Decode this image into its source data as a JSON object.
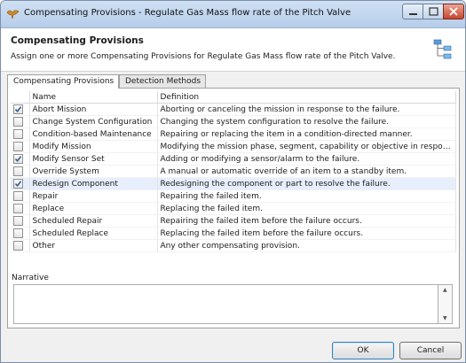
{
  "window": {
    "title": "Compensating Provisions - Regulate Gas Mass flow rate of the Pitch Valve"
  },
  "header": {
    "title": "Compensating Provisions",
    "subtitle": "Assign one or more Compensating Provisions for Regulate Gas Mass flow rate of the Pitch Valve."
  },
  "tabs": [
    {
      "label": "Compensating Provisions",
      "active": true
    },
    {
      "label": "Detection Methods",
      "active": false
    }
  ],
  "table": {
    "columns": [
      "Name",
      "Definition"
    ],
    "rows": [
      {
        "checked": true,
        "name": "Abort Mission",
        "definition": "Aborting or canceling the mission in response to the failure."
      },
      {
        "checked": false,
        "name": "Change System Configuration",
        "definition": "Changing the system configuration to resolve the failure."
      },
      {
        "checked": false,
        "name": "Condition-based Maintenance",
        "definition": "Repairing or replacing the item in a condition-directed manner."
      },
      {
        "checked": false,
        "name": "Modify Mission",
        "definition": "Modifying the mission phase, segment, capability or objective in response ..."
      },
      {
        "checked": true,
        "name": "Modify Sensor Set",
        "definition": "Adding or modifying a sensor/alarm to the failure."
      },
      {
        "checked": false,
        "name": "Override System",
        "definition": "A manual or automatic override of an item to a standby item."
      },
      {
        "checked": true,
        "name": "Redesign Component",
        "definition": "Redesigning the component or part to resolve the failure.",
        "selected": true
      },
      {
        "checked": false,
        "name": "Repair",
        "definition": "Repairing the failed item."
      },
      {
        "checked": false,
        "name": "Replace",
        "definition": "Replacing the failed item."
      },
      {
        "checked": false,
        "name": "Scheduled Repair",
        "definition": "Repairing the failed item before the failure occurs."
      },
      {
        "checked": false,
        "name": "Scheduled Replace",
        "definition": "Replacing the failed item before the failure occurs."
      },
      {
        "checked": false,
        "name": "Other",
        "definition": "Any other compensating provision."
      }
    ]
  },
  "narrative": {
    "label": "Narrative",
    "value": ""
  },
  "buttons": {
    "ok": "OK",
    "cancel": "Cancel"
  },
  "icons": {
    "app": "bird-logo-icon",
    "header": "tree-structure-icon"
  },
  "colors": {
    "title_bar": "#c4d8ef",
    "selected_row": "#e7eefc",
    "close_button": "#c9452c"
  }
}
